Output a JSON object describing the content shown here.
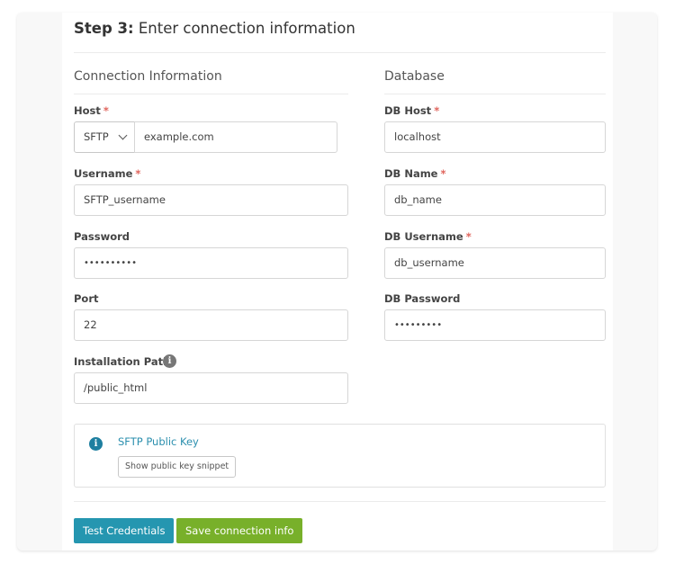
{
  "header": {
    "step_label": "Step 3:",
    "title": "Enter connection information"
  },
  "connection": {
    "section_title": "Connection Information",
    "host": {
      "label": "Host",
      "required_mark": "*",
      "protocol": "SFTP",
      "value": "example.com"
    },
    "username": {
      "label": "Username",
      "required_mark": "*",
      "value": "SFTP_username"
    },
    "password": {
      "label": "Password",
      "value": "••••••••••"
    },
    "port": {
      "label": "Port",
      "value": "22"
    },
    "install_path": {
      "label": "Installation Path",
      "info_icon": "i",
      "value": "/public_html"
    }
  },
  "database": {
    "section_title": "Database",
    "db_host": {
      "label": "DB Host",
      "required_mark": "*",
      "value": "localhost"
    },
    "db_name": {
      "label": "DB Name",
      "required_mark": "*",
      "value": "db_name"
    },
    "db_username": {
      "label": "DB Username",
      "required_mark": "*",
      "value": "db_username"
    },
    "db_password": {
      "label": "DB Password",
      "value": "•••••••••"
    }
  },
  "public_key": {
    "icon": "i",
    "title": "SFTP Public Key",
    "button_label": "Show public key snippet"
  },
  "actions": {
    "test_label": "Test Credentials",
    "save_label": "Save connection info"
  },
  "colors": {
    "primary": "#2596b0",
    "success": "#78b02a",
    "required": "#e0645c",
    "link": "#2b8fae",
    "info_icon_dark": "#1e7fa0",
    "info_icon_gray": "#777777"
  }
}
